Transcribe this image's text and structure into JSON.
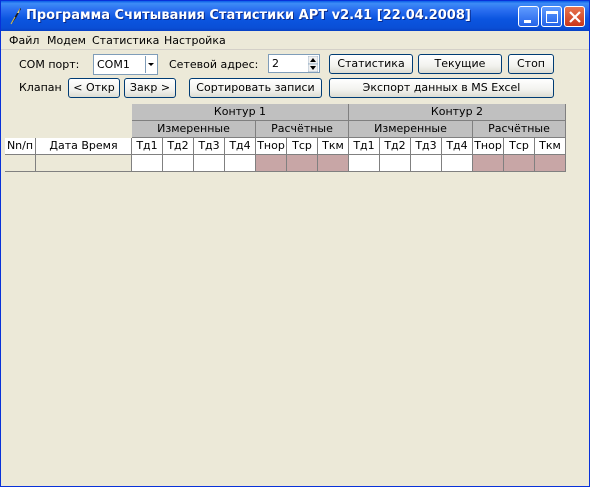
{
  "window": {
    "title": "Программа Считывания Статистики АРТ v2.41 [22.04.2008]",
    "title_color": "#0a55e0",
    "icon": "feather-pen-icon",
    "controls": [
      "minimize-icon",
      "maximize-icon",
      "close-icon"
    ]
  },
  "menu": {
    "file": "Файл",
    "modem": "Модем",
    "stats": "Статистика",
    "settings": "Настройка"
  },
  "toolbar": {
    "com_port_label": "COM порт:",
    "com_port_value": "COM1",
    "net_address_label": "Сетевой адрес:",
    "net_address_value": "2",
    "stats_button": "Статистика",
    "current_button": "Текущие",
    "stop_button": "Стоп",
    "valve_label": "Клапан",
    "open_button": "< Откр",
    "close_button": "Закр >",
    "sort_button": "Сортировать записи",
    "export_button": "Экспорт данных в MS Excel"
  },
  "table": {
    "contour1": "Контур 1",
    "contour2": "Контур 2",
    "measured": "Измеренные",
    "calculated": "Расчётные",
    "col_num": "Nn/п",
    "col_datetime": "Дата Время",
    "measured_cols": [
      "Тд1",
      "Тд2",
      "Тд3",
      "Тд4"
    ],
    "calculated_cols": [
      "Тнор",
      "Тср",
      "Ткм"
    ],
    "calc_cell_color": "#c8a6a6"
  }
}
